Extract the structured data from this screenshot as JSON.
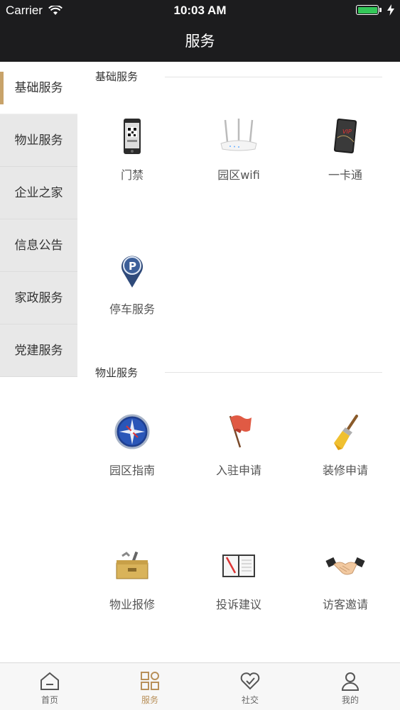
{
  "status_bar": {
    "carrier": "Carrier",
    "time": "10:03 AM"
  },
  "nav": {
    "title": "服务"
  },
  "sidebar": {
    "items": [
      {
        "label": "基础服务",
        "active": true
      },
      {
        "label": "物业服务",
        "active": false
      },
      {
        "label": "企业之家",
        "active": false
      },
      {
        "label": "信息公告",
        "active": false
      },
      {
        "label": "家政服务",
        "active": false
      },
      {
        "label": "党建服务",
        "active": false
      }
    ]
  },
  "sections": [
    {
      "title": "基础服务",
      "items": [
        {
          "label": "门禁",
          "icon": "phone-qr-icon"
        },
        {
          "label": "园区wifi",
          "icon": "router-icon"
        },
        {
          "label": "一卡通",
          "icon": "vip-card-icon"
        },
        {
          "label": "停车服务",
          "icon": "parking-pin-icon"
        }
      ]
    },
    {
      "title": "物业服务",
      "items": [
        {
          "label": "园区指南",
          "icon": "compass-icon"
        },
        {
          "label": "入驻申请",
          "icon": "flag-icon"
        },
        {
          "label": "装修申请",
          "icon": "paint-brush-icon"
        },
        {
          "label": "物业报修",
          "icon": "toolbox-icon"
        },
        {
          "label": "投诉建议",
          "icon": "notebook-icon"
        },
        {
          "label": "访客邀请",
          "icon": "handshake-icon"
        }
      ]
    }
  ],
  "tabbar": {
    "items": [
      {
        "label": "首页",
        "icon": "home-icon",
        "active": false
      },
      {
        "label": "服务",
        "icon": "grid-icon",
        "active": true
      },
      {
        "label": "社交",
        "icon": "heart-check-icon",
        "active": false
      },
      {
        "label": "我的",
        "icon": "user-icon",
        "active": false
      }
    ]
  },
  "colors": {
    "accent": "#c8a36a",
    "nav_bg": "#1c1c1e",
    "sidebar_bg": "#e8e8e8",
    "tab_active": "#b8905a"
  }
}
